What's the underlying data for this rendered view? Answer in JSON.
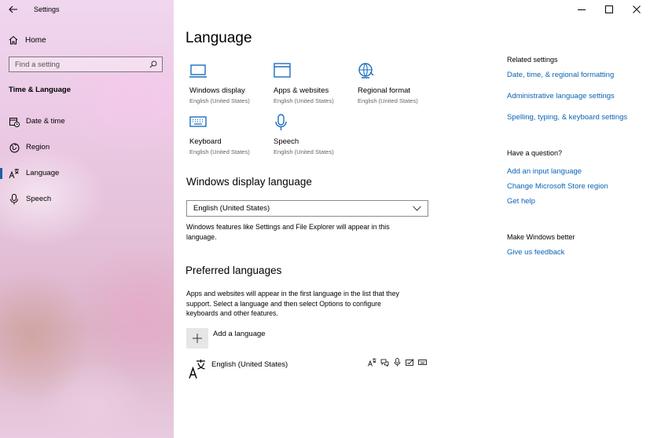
{
  "app": {
    "title": "Settings"
  },
  "sidebar": {
    "home_label": "Home",
    "search_placeholder": "Find a setting",
    "section_title": "Time & Language",
    "items": [
      {
        "label": "Date & time",
        "icon": "date-time-icon",
        "selected": false
      },
      {
        "label": "Region",
        "icon": "globe-icon",
        "selected": false
      },
      {
        "label": "Language",
        "icon": "language-icon",
        "selected": true
      },
      {
        "label": "Speech",
        "icon": "microphone-icon",
        "selected": false
      }
    ]
  },
  "main": {
    "title": "Language",
    "tiles": [
      {
        "title": "Windows display",
        "subtitle": "English (United States)",
        "icon": "monitor-icon"
      },
      {
        "title": "Apps & websites",
        "subtitle": "English (United States)",
        "icon": "app-window-icon"
      },
      {
        "title": "Regional format",
        "subtitle": "English (United States)",
        "icon": "regional-format-icon"
      },
      {
        "title": "Keyboard",
        "subtitle": "English (United States)",
        "icon": "keyboard-icon"
      },
      {
        "title": "Speech",
        "subtitle": "English (United States)",
        "icon": "microphone-icon"
      }
    ],
    "display_language": {
      "heading": "Windows display language",
      "selected": "English (United States)",
      "description_line1": "Windows features like Settings and File Explorer will appear in this",
      "description_line2": "language."
    },
    "preferred": {
      "heading": "Preferred languages",
      "description_line1": "Apps and websites will appear in the first language in the list that they",
      "description_line2": "support. Select a language and then select Options to configure",
      "description_line3": "keyboards and other features.",
      "add_label": "Add a language",
      "languages": [
        {
          "name": "English (United States)",
          "capabilities": [
            "display-language-icon",
            "text-to-speech-icon",
            "speech-recognition-icon",
            "handwriting-icon",
            "keyboard-icon"
          ]
        }
      ]
    }
  },
  "related": {
    "heading": "Related settings",
    "links": [
      "Date, time, & regional formatting",
      "Administrative language settings",
      "Spelling, typing, & keyboard settings"
    ],
    "question_heading": "Have a question?",
    "question_links": [
      "Add an input language",
      "Change Microsoft Store region",
      "Get help"
    ],
    "better_heading": "Make Windows better",
    "feedback_link": "Give us feedback"
  },
  "colors": {
    "accent": "#0a64b4",
    "selection_bar": "#1a5fa8",
    "tile_icon": "#1a6fc0"
  }
}
